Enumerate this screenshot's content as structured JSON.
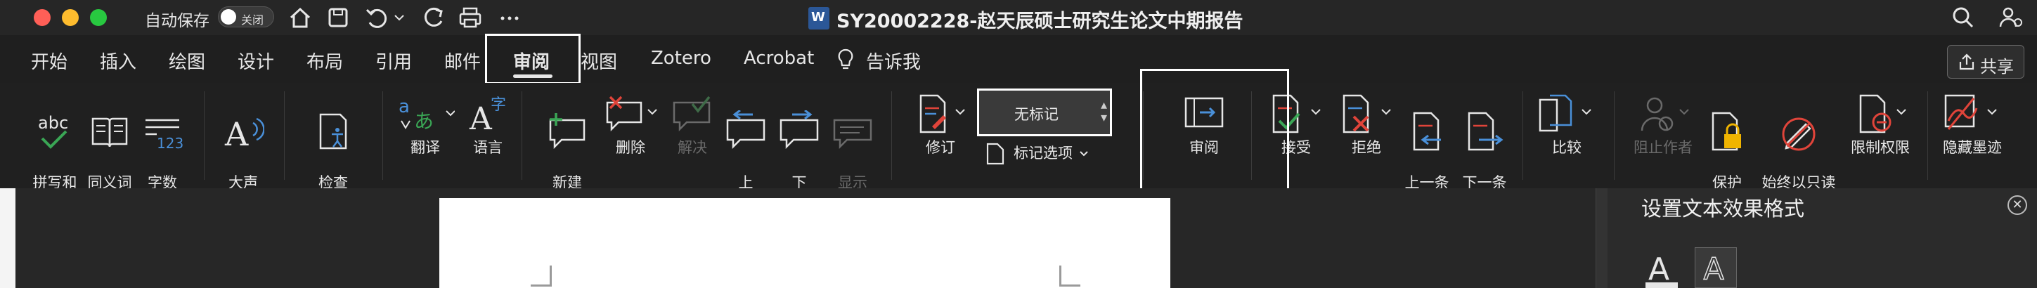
{
  "titlebar": {
    "autosave_label": "自动保存",
    "autosave_state": "关闭",
    "document_title": "SY20002228-赵天辰硕士研究生论文中期报告",
    "title_dropdown_icon": "chevron-down-icon",
    "word_badge": "W"
  },
  "tabs": [
    {
      "label": "开始"
    },
    {
      "label": "插入"
    },
    {
      "label": "绘图"
    },
    {
      "label": "设计"
    },
    {
      "label": "布局"
    },
    {
      "label": "引用"
    },
    {
      "label": "邮件"
    },
    {
      "label": "审阅"
    },
    {
      "label": "视图"
    },
    {
      "label": "Zotero"
    },
    {
      "label": "Acrobat"
    },
    {
      "label": "告诉我"
    }
  ],
  "active_tab": "审阅",
  "share_label": "共享",
  "ribbon": {
    "spelling": "拼写和\n语法",
    "thesaurus": "同义词\n库",
    "wordcount": "字数\n统计",
    "readaloud": "大声\n朗读",
    "accessibility": "检查\n辅助功能",
    "translate": "翻译",
    "language": "语言",
    "newcomment": "新建\n注释",
    "delete": "删除",
    "resolve": "解决",
    "prev": "上\n一个",
    "next": "下\n一个",
    "showcomments": "显示\n批注",
    "track": "修订",
    "markup_value": "无标记",
    "markup_options": "标记选项",
    "review": "审阅",
    "accept": "接受",
    "reject": "拒绝",
    "prevchange": "上一条\n修订",
    "nextchange": "下一条\n修订",
    "compare": "比较",
    "blockauthors": "阻止作者",
    "protect": "保护\n文档",
    "alwaysreadonly": "始终以只读\n方式打开",
    "restrict": "限制权限",
    "hideink": "隐藏墨迹"
  },
  "sidepane": {
    "title": "设置文本效果格式",
    "close_icon": "close-icon"
  },
  "colors": {
    "accent_blue": "#4a90d9",
    "accent_red": "#e0443a",
    "accent_green": "#3aa655",
    "brand_word": "#2b5797"
  }
}
